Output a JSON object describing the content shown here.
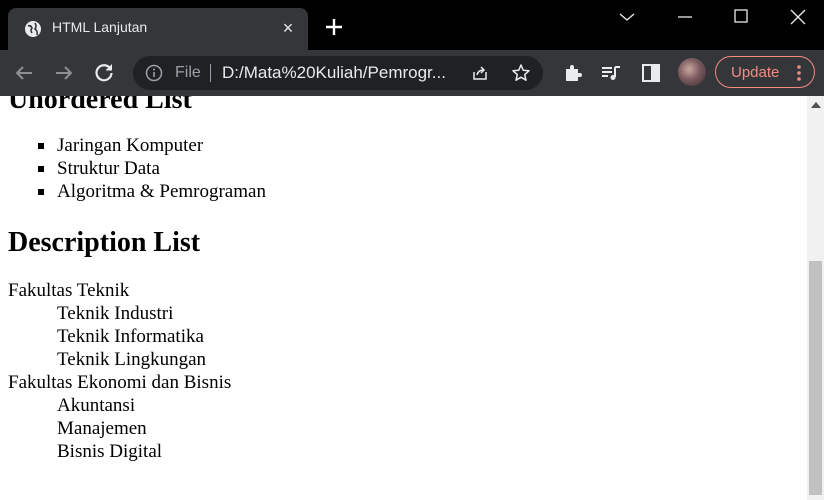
{
  "browser": {
    "tab": {
      "title": "HTML Lanjutan",
      "icon": "globe-icon",
      "close_label": "×"
    },
    "toolbar": {
      "omnibox": {
        "scheme_label": "File",
        "url": "D:/Mata%20Kuliah/Pemrogr..."
      },
      "update_label": "Update"
    },
    "colors": {
      "titlebar": "#000000",
      "toolbar": "#35363a",
      "omnibox": "#202124",
      "update_accent": "#f28b82"
    }
  },
  "page": {
    "unordered": {
      "heading": "Unordered List",
      "items": [
        "Jaringan Komputer",
        "Struktur Data",
        "Algoritma & Pemrograman"
      ]
    },
    "description": {
      "heading": "Description List",
      "groups": [
        {
          "term": "Fakultas Teknik",
          "descs": [
            "Teknik Industri",
            "Teknik Informatika",
            "Teknik Lingkungan"
          ]
        },
        {
          "term": "Fakultas Ekonomi dan Bisnis",
          "descs": [
            "Akuntansi",
            "Manajemen",
            "Bisnis Digital"
          ]
        }
      ]
    }
  }
}
